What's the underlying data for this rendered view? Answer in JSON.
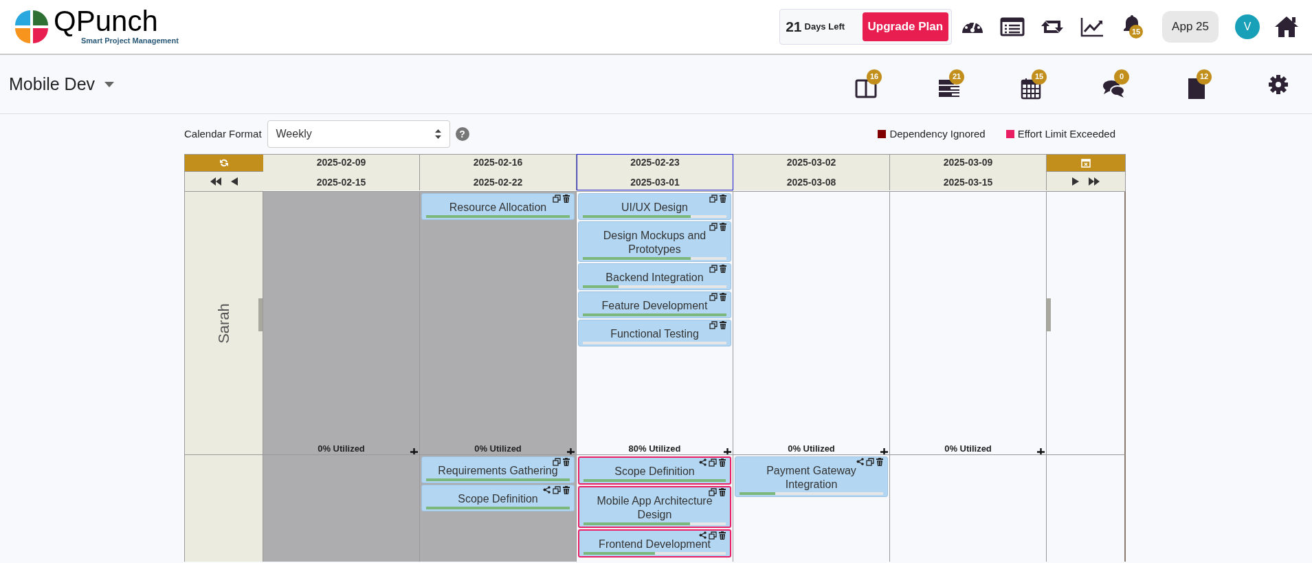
{
  "header": {
    "logo_name": "QPunch",
    "logo_tagline": "Smart Project Management",
    "trial_days": "21",
    "trial_label": "Days Left",
    "upgrade_button": "Upgrade Plan",
    "nav": [
      {
        "kind": "dashboard"
      },
      {
        "kind": "list"
      },
      {
        "kind": "repeat"
      },
      {
        "kind": "chart"
      },
      {
        "kind": "bell",
        "badge": "15"
      }
    ],
    "app_button": "App 25",
    "avatar_initial": "V"
  },
  "project": {
    "name": "Mobile Dev",
    "tools": [
      {
        "kind": "board",
        "badge": "16"
      },
      {
        "kind": "stack",
        "badge": "21"
      },
      {
        "kind": "calendar",
        "badge": "15"
      },
      {
        "kind": "chat",
        "badge": "0"
      },
      {
        "kind": "document",
        "badge": "12"
      },
      {
        "kind": "settings"
      }
    ]
  },
  "calendar": {
    "format_label": "Calendar Format",
    "format_value": "Weekly",
    "help_icon": "?",
    "legend": [
      {
        "label": "Dependency Ignored",
        "color": "#800000"
      },
      {
        "label": "Effort Limit Exceeded",
        "color": "#e91e63"
      }
    ],
    "weeks": [
      {
        "start": "2025-02-09",
        "end": "2025-02-15",
        "past": true,
        "current": false
      },
      {
        "start": "2025-02-16",
        "end": "2025-02-22",
        "past": true,
        "current": false
      },
      {
        "start": "2025-02-23",
        "end": "2025-03-01",
        "past": false,
        "current": true
      },
      {
        "start": "2025-03-02",
        "end": "2025-03-08",
        "past": false,
        "current": false
      },
      {
        "start": "2025-03-09",
        "end": "2025-03-15",
        "past": false,
        "current": false
      }
    ],
    "rows": [
      {
        "resource": "Sarah",
        "cells": [
          {
            "utilization": "0% Utilized"
          },
          {
            "utilization": "0% Utilized",
            "tasks": [
              {
                "name": "Resource Allocation",
                "level": 1,
                "dependency": false,
                "exceeded": false
              }
            ]
          },
          {
            "utilization": "80% Utilized",
            "tasks": [
              {
                "name": "UI/UX Design",
                "level": 0.75,
                "dependency": false,
                "exceeded": false
              },
              {
                "name": "Design Mockups and Prototypes",
                "level": 0.75,
                "dependency": false,
                "exceeded": false
              },
              {
                "name": "Backend Integration",
                "level": 0.25,
                "dependency": false,
                "exceeded": false
              },
              {
                "name": "Feature Development",
                "level": 1,
                "dependency": false,
                "exceeded": false
              },
              {
                "name": "Functional Testing",
                "level": 0,
                "dependency": false,
                "exceeded": false
              }
            ]
          },
          {
            "utilization": "0% Utilized"
          },
          {
            "utilization": "0% Utilized"
          }
        ]
      },
      {
        "cells": [
          {},
          {
            "tasks": [
              {
                "name": "Requirements Gathering",
                "level": 1,
                "dependency": false,
                "exceeded": false
              },
              {
                "name": "Scope Definition",
                "level": 1,
                "dependency": true,
                "exceeded": false
              }
            ]
          },
          {
            "tasks": [
              {
                "name": "Scope Definition",
                "level": 1,
                "dependency": true,
                "exceeded": true
              },
              {
                "name": "Mobile App Architecture Design",
                "level": 0.75,
                "dependency": false,
                "exceeded": true
              },
              {
                "name": "Frontend Development",
                "level": 0.5,
                "dependency": true,
                "exceeded": true
              }
            ]
          },
          {
            "tasks": [
              {
                "name": "Payment Gateway Integration",
                "level": 0.25,
                "dependency": true,
                "exceeded": false
              }
            ]
          },
          {}
        ]
      }
    ]
  }
}
